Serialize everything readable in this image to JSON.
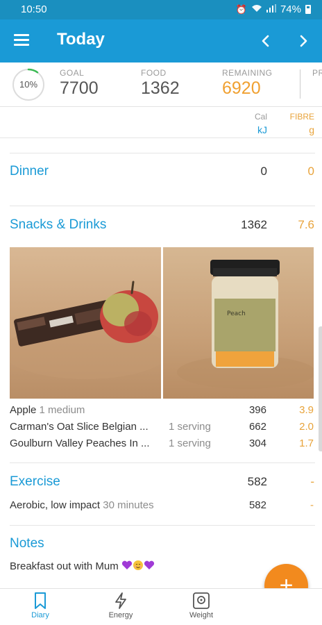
{
  "status_bar": {
    "time": "10:50",
    "battery": "74%"
  },
  "app_bar": {
    "title": "Today"
  },
  "summary": {
    "progress": "10%",
    "progress_fraction": 0.1,
    "goal_label": "GOAL",
    "goal_value": "7700",
    "food_label": "FOOD",
    "food_value": "1362",
    "remaining_label": "REMAINING",
    "remaining_value": "6920",
    "next_label": "PR"
  },
  "units": {
    "cal": "Cal",
    "kj": "kJ",
    "fibre": "FIBRE",
    "g": "g"
  },
  "dinner": {
    "title": "Dinner",
    "kj": "0",
    "fibre": "0"
  },
  "snacks": {
    "title": "Snacks & Drinks",
    "kj": "1362",
    "fibre": "7.6",
    "items": [
      {
        "name": "Apple",
        "portion": "1 medium",
        "serving": "",
        "kj": "396",
        "fibre": "3.9"
      },
      {
        "name": "Carman's Oat Slice Belgian ...",
        "portion": "",
        "serving": "1 serving",
        "kj": "662",
        "fibre": "2.0"
      },
      {
        "name": "Goulburn Valley Peaches In ...",
        "portion": "",
        "serving": "1 serving",
        "kj": "304",
        "fibre": "1.7"
      }
    ]
  },
  "exercise": {
    "title": "Exercise",
    "kj": "582",
    "fibre": "-",
    "items": [
      {
        "name": "Aerobic, low impact",
        "duration": "30 minutes",
        "kj": "582",
        "fibre": "-"
      }
    ]
  },
  "notes": {
    "title": "Notes",
    "text": "Breakfast out with Mum"
  },
  "fab": {
    "label": "+"
  },
  "bottom_nav": [
    {
      "label": "Diary",
      "icon": "bookmark-icon"
    },
    {
      "label": "Energy",
      "icon": "lightning-icon"
    },
    {
      "label": "Weight",
      "icon": "scale-icon"
    }
  ],
  "colors": {
    "primary": "#1a9ad6",
    "status": "#1a8fbf",
    "accent": "#f0a030",
    "fab": "#f28a1e",
    "progress": "#3cba54"
  }
}
